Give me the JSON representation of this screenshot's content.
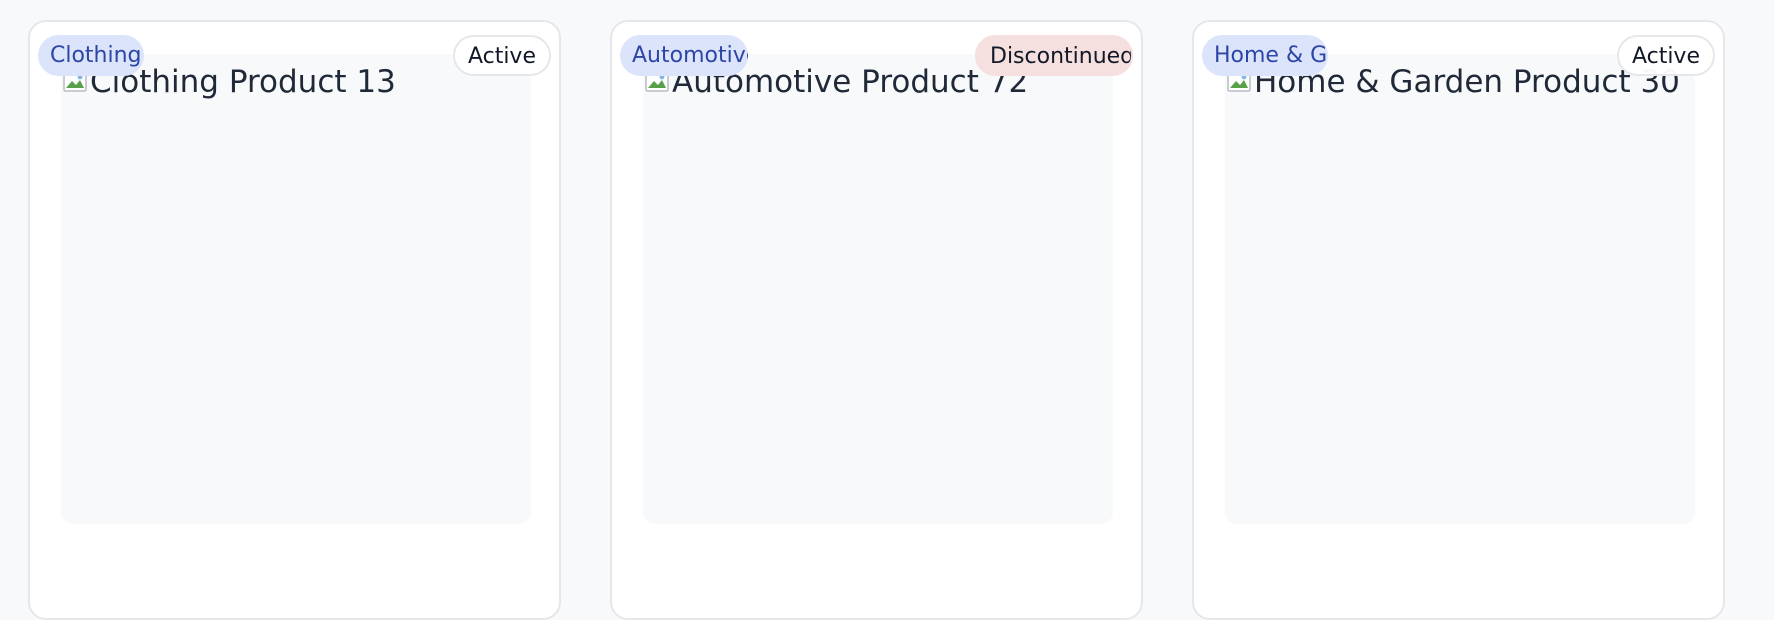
{
  "cards": [
    {
      "category": "Clothing",
      "status": "Active",
      "image_alt": "Clothing Product 13",
      "status_color": "#e5e7eb"
    },
    {
      "category": "Automotive",
      "status": "Discontinued",
      "image_alt": "Automotive Product 72",
      "status_color": "#f5dfdf"
    },
    {
      "category": "Home & Garden",
      "status": "Active",
      "image_alt": "Home & Garden Product 30",
      "status_color": "#e5e7eb"
    }
  ],
  "colors": {
    "page_background": "#f8f9fb",
    "card_background": "#ffffff",
    "card_border": "#e5e7eb",
    "category_badge_background": "#dbe4fb",
    "category_badge_text": "#2d46a6"
  },
  "icons": {
    "broken_image": "broken-image-icon"
  }
}
